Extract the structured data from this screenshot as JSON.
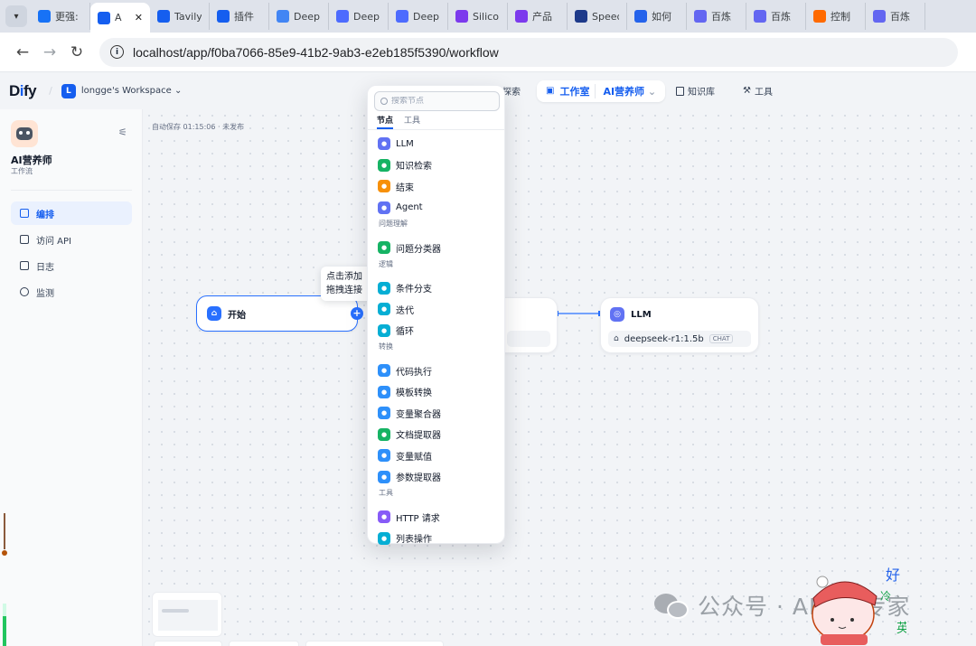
{
  "browser": {
    "tabs": [
      {
        "title": "更强:",
        "icon": "zhihu-icon",
        "color": "#1772f6"
      },
      {
        "title": "A",
        "icon": "dify-icon",
        "color": "#155eef",
        "active": true
      },
      {
        "title": "Tavily",
        "icon": "dify-icon",
        "color": "#155eef"
      },
      {
        "title": "插件",
        "icon": "dify-icon",
        "color": "#155eef"
      },
      {
        "title": "Deep",
        "icon": "google-icon",
        "color": "#4285f4"
      },
      {
        "title": "Deep",
        "icon": "deepseek-icon",
        "color": "#4d6bfe"
      },
      {
        "title": "Deep",
        "icon": "deepseek-icon",
        "color": "#4d6bfe"
      },
      {
        "title": "Silico",
        "icon": "siliconflow-icon",
        "color": "#7c3aed"
      },
      {
        "title": "产品",
        "icon": "siliconflow-icon",
        "color": "#7c3aed"
      },
      {
        "title": "Speed",
        "icon": "speedtest-icon",
        "color": "#1e3a8a"
      },
      {
        "title": "如何",
        "icon": "bookmark-icon",
        "color": "#2563eb"
      },
      {
        "title": "百炼",
        "icon": "bailian-icon",
        "color": "#6366f1"
      },
      {
        "title": "百炼",
        "icon": "bailian-icon",
        "color": "#6366f1"
      },
      {
        "title": "控制",
        "icon": "aliyun-icon",
        "color": "#ff6a00"
      },
      {
        "title": "百炼",
        "icon": "bailian-icon",
        "color": "#6366f1"
      }
    ],
    "url": "localhost/app/f0ba7066-85e9-41b2-9ab3-e2eb185f5390/workflow"
  },
  "header": {
    "logo_prefix": "D",
    "logo_i": "i",
    "logo_suffix": "fy",
    "workspace_initial": "L",
    "workspace_name": "longge's Workspace",
    "explore_label": "探索",
    "studio_label": "工作室",
    "app_name": "AI营养师",
    "knowledge_label": "知识库",
    "tools_label": "工具"
  },
  "sidebar": {
    "app_title": "AI营养师",
    "app_subtitle": "工作流",
    "items": [
      {
        "label": "编排",
        "icon": "layout-icon",
        "active": true
      },
      {
        "label": "访问 API",
        "icon": "terminal-icon"
      },
      {
        "label": "日志",
        "icon": "file-icon"
      },
      {
        "label": "监测",
        "icon": "monitor-icon"
      }
    ]
  },
  "canvas": {
    "autosave": "自动保存 01:15:06 · 未发布",
    "start_node": {
      "title": "开始"
    },
    "llm_node": {
      "title": "LLM",
      "model": "deepseek-r1:1.5b",
      "badge": "CHAT"
    },
    "tooltip": {
      "line1": "点击添加",
      "line2": "拖拽连接"
    }
  },
  "picker": {
    "search_placeholder": "搜索节点",
    "tabs": [
      "节点",
      "工具"
    ],
    "items": [
      {
        "label": "LLM",
        "color": "#6172f3"
      },
      {
        "label": "知识检索",
        "color": "#16b364"
      },
      {
        "label": "结束",
        "color": "#f79009"
      },
      {
        "label": "Agent",
        "color": "#6172f3"
      },
      {
        "section": "问题理解"
      },
      {
        "label": "问题分类器",
        "color": "#16b364"
      },
      {
        "section": "逻辑"
      },
      {
        "label": "条件分支",
        "color": "#06aed4"
      },
      {
        "label": "迭代",
        "color": "#06aed4"
      },
      {
        "label": "循环",
        "color": "#06aed4"
      },
      {
        "section": "转换"
      },
      {
        "label": "代码执行",
        "color": "#2e90fa"
      },
      {
        "label": "模板转换",
        "color": "#2e90fa"
      },
      {
        "label": "变量聚合器",
        "color": "#2e90fa"
      },
      {
        "label": "文档提取器",
        "color": "#16b364"
      },
      {
        "label": "变量赋值",
        "color": "#2e90fa"
      },
      {
        "label": "参数提取器",
        "color": "#2e90fa"
      },
      {
        "section": "工具"
      },
      {
        "label": "HTTP 请求",
        "color": "#875bf7"
      },
      {
        "label": "列表操作",
        "color": "#06aed4"
      }
    ]
  },
  "watermark": {
    "text": "公众号 · AI技术专家",
    "mascot_text": [
      "好",
      "冷",
      "英"
    ]
  }
}
